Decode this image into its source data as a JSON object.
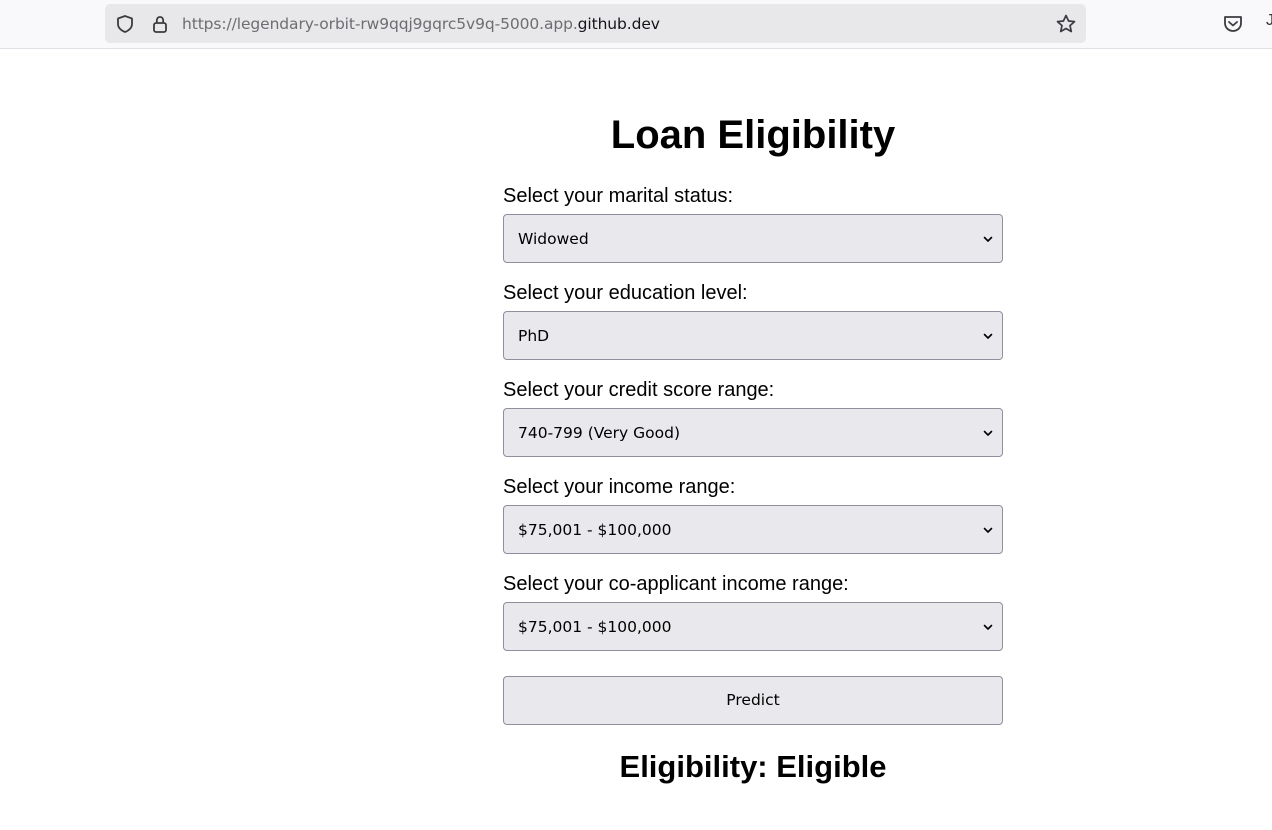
{
  "browser": {
    "url_prefix": "https://legendary-orbit-rw9qqj9gqrc5v9q-5000.app.",
    "url_host": "github.dev"
  },
  "page": {
    "title": "Loan Eligibility",
    "fields": [
      {
        "label": "Select your marital status:",
        "value": "Widowed"
      },
      {
        "label": "Select your education level:",
        "value": "PhD"
      },
      {
        "label": "Select your credit score range:",
        "value": "740-799 (Very Good)"
      },
      {
        "label": "Select your income range:",
        "value": "$75,001 - $100,000"
      },
      {
        "label": "Select your co-applicant income range:",
        "value": "$75,001 - $100,000"
      }
    ],
    "predict_label": "Predict",
    "result": "Eligibility: Eligible"
  }
}
